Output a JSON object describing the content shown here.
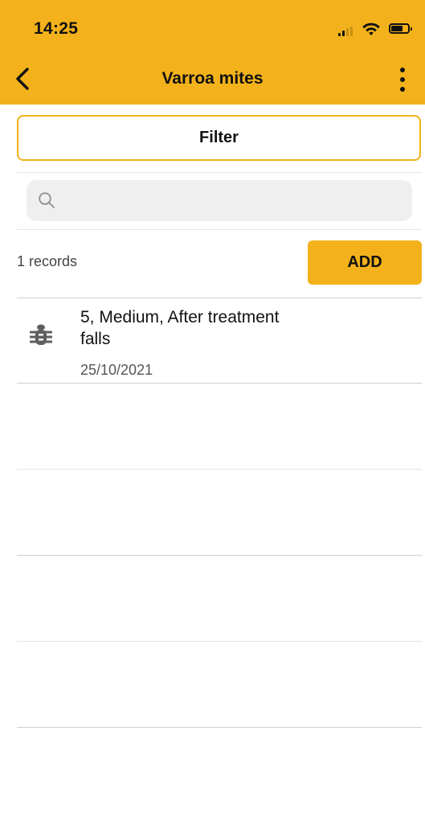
{
  "status_bar": {
    "time": "14:25"
  },
  "header": {
    "title": "Varroa mites",
    "back_icon": "chevron-left-icon",
    "more_icon": "more-vertical-icon",
    "background_color": "#f3b21b"
  },
  "filter": {
    "label": "Filter"
  },
  "search": {
    "placeholder": "",
    "icon": "search-icon"
  },
  "records": {
    "count_label": "1 records",
    "add_label": "ADD",
    "items": [
      {
        "icon": "bug-icon",
        "title": "5, Medium, After treatment falls",
        "date": "25/10/2021"
      }
    ]
  }
}
